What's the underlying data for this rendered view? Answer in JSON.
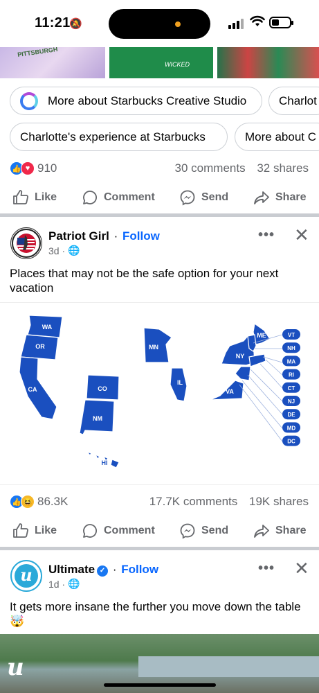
{
  "status": {
    "time": "11:21"
  },
  "top_post": {
    "images": {
      "img1_text": "PITTSBURGH",
      "img2_text": "WICKED"
    },
    "chips": [
      "More about Starbucks Creative Studio",
      "Charlot",
      "Charlotte's experience at Starbucks",
      "More about C"
    ],
    "reactions": {
      "count": "910",
      "comments": "30 comments",
      "shares": "32 shares"
    }
  },
  "actions": {
    "like": "Like",
    "comment": "Comment",
    "send": "Send",
    "share": "Share"
  },
  "post2": {
    "name": "Patriot Girl",
    "sep": "·",
    "follow": "Follow",
    "time": "3d ·",
    "text": "Places that may not be the safe option for your next vacation",
    "map_labels": {
      "WA": "WA",
      "OR": "OR",
      "CA": "CA",
      "CO": "CO",
      "NM": "NM",
      "MN": "MN",
      "IL": "IL",
      "NY": "NY",
      "ME": "ME",
      "VA": "VA",
      "HI": "HI",
      "pills": [
        "VT",
        "NH",
        "MA",
        "RI",
        "CT",
        "NJ",
        "DE",
        "MD",
        "DC"
      ]
    },
    "reactions": {
      "count": "86.3K",
      "comments": "17.7K comments",
      "shares": "19K shares"
    }
  },
  "post3": {
    "name": "Ultimate",
    "sep": "·",
    "follow": "Follow",
    "time": "1d ·",
    "text": "It gets more insane the further you move down the table 🤯",
    "logo": "u"
  },
  "colors": {
    "accent": "#0866ff",
    "map_fill": "#1a4fbf",
    "divider": "#c9ccd1"
  }
}
